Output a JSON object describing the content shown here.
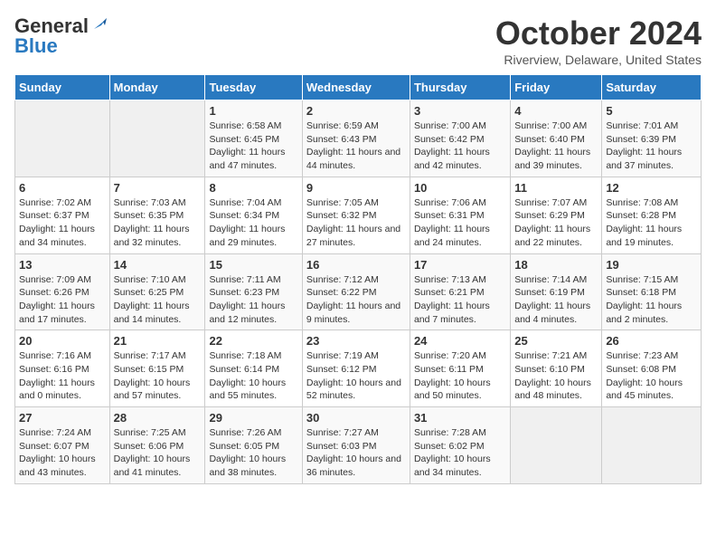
{
  "logo": {
    "line1": "General",
    "line2": "Blue"
  },
  "title": "October 2024",
  "subtitle": "Riverview, Delaware, United States",
  "days_of_week": [
    "Sunday",
    "Monday",
    "Tuesday",
    "Wednesday",
    "Thursday",
    "Friday",
    "Saturday"
  ],
  "weeks": [
    [
      {
        "day": "",
        "info": ""
      },
      {
        "day": "",
        "info": ""
      },
      {
        "day": "1",
        "info": "Sunrise: 6:58 AM\nSunset: 6:45 PM\nDaylight: 11 hours and 47 minutes."
      },
      {
        "day": "2",
        "info": "Sunrise: 6:59 AM\nSunset: 6:43 PM\nDaylight: 11 hours and 44 minutes."
      },
      {
        "day": "3",
        "info": "Sunrise: 7:00 AM\nSunset: 6:42 PM\nDaylight: 11 hours and 42 minutes."
      },
      {
        "day": "4",
        "info": "Sunrise: 7:00 AM\nSunset: 6:40 PM\nDaylight: 11 hours and 39 minutes."
      },
      {
        "day": "5",
        "info": "Sunrise: 7:01 AM\nSunset: 6:39 PM\nDaylight: 11 hours and 37 minutes."
      }
    ],
    [
      {
        "day": "6",
        "info": "Sunrise: 7:02 AM\nSunset: 6:37 PM\nDaylight: 11 hours and 34 minutes."
      },
      {
        "day": "7",
        "info": "Sunrise: 7:03 AM\nSunset: 6:35 PM\nDaylight: 11 hours and 32 minutes."
      },
      {
        "day": "8",
        "info": "Sunrise: 7:04 AM\nSunset: 6:34 PM\nDaylight: 11 hours and 29 minutes."
      },
      {
        "day": "9",
        "info": "Sunrise: 7:05 AM\nSunset: 6:32 PM\nDaylight: 11 hours and 27 minutes."
      },
      {
        "day": "10",
        "info": "Sunrise: 7:06 AM\nSunset: 6:31 PM\nDaylight: 11 hours and 24 minutes."
      },
      {
        "day": "11",
        "info": "Sunrise: 7:07 AM\nSunset: 6:29 PM\nDaylight: 11 hours and 22 minutes."
      },
      {
        "day": "12",
        "info": "Sunrise: 7:08 AM\nSunset: 6:28 PM\nDaylight: 11 hours and 19 minutes."
      }
    ],
    [
      {
        "day": "13",
        "info": "Sunrise: 7:09 AM\nSunset: 6:26 PM\nDaylight: 11 hours and 17 minutes."
      },
      {
        "day": "14",
        "info": "Sunrise: 7:10 AM\nSunset: 6:25 PM\nDaylight: 11 hours and 14 minutes."
      },
      {
        "day": "15",
        "info": "Sunrise: 7:11 AM\nSunset: 6:23 PM\nDaylight: 11 hours and 12 minutes."
      },
      {
        "day": "16",
        "info": "Sunrise: 7:12 AM\nSunset: 6:22 PM\nDaylight: 11 hours and 9 minutes."
      },
      {
        "day": "17",
        "info": "Sunrise: 7:13 AM\nSunset: 6:21 PM\nDaylight: 11 hours and 7 minutes."
      },
      {
        "day": "18",
        "info": "Sunrise: 7:14 AM\nSunset: 6:19 PM\nDaylight: 11 hours and 4 minutes."
      },
      {
        "day": "19",
        "info": "Sunrise: 7:15 AM\nSunset: 6:18 PM\nDaylight: 11 hours and 2 minutes."
      }
    ],
    [
      {
        "day": "20",
        "info": "Sunrise: 7:16 AM\nSunset: 6:16 PM\nDaylight: 11 hours and 0 minutes."
      },
      {
        "day": "21",
        "info": "Sunrise: 7:17 AM\nSunset: 6:15 PM\nDaylight: 10 hours and 57 minutes."
      },
      {
        "day": "22",
        "info": "Sunrise: 7:18 AM\nSunset: 6:14 PM\nDaylight: 10 hours and 55 minutes."
      },
      {
        "day": "23",
        "info": "Sunrise: 7:19 AM\nSunset: 6:12 PM\nDaylight: 10 hours and 52 minutes."
      },
      {
        "day": "24",
        "info": "Sunrise: 7:20 AM\nSunset: 6:11 PM\nDaylight: 10 hours and 50 minutes."
      },
      {
        "day": "25",
        "info": "Sunrise: 7:21 AM\nSunset: 6:10 PM\nDaylight: 10 hours and 48 minutes."
      },
      {
        "day": "26",
        "info": "Sunrise: 7:23 AM\nSunset: 6:08 PM\nDaylight: 10 hours and 45 minutes."
      }
    ],
    [
      {
        "day": "27",
        "info": "Sunrise: 7:24 AM\nSunset: 6:07 PM\nDaylight: 10 hours and 43 minutes."
      },
      {
        "day": "28",
        "info": "Sunrise: 7:25 AM\nSunset: 6:06 PM\nDaylight: 10 hours and 41 minutes."
      },
      {
        "day": "29",
        "info": "Sunrise: 7:26 AM\nSunset: 6:05 PM\nDaylight: 10 hours and 38 minutes."
      },
      {
        "day": "30",
        "info": "Sunrise: 7:27 AM\nSunset: 6:03 PM\nDaylight: 10 hours and 36 minutes."
      },
      {
        "day": "31",
        "info": "Sunrise: 7:28 AM\nSunset: 6:02 PM\nDaylight: 10 hours and 34 minutes."
      },
      {
        "day": "",
        "info": ""
      },
      {
        "day": "",
        "info": ""
      }
    ]
  ]
}
